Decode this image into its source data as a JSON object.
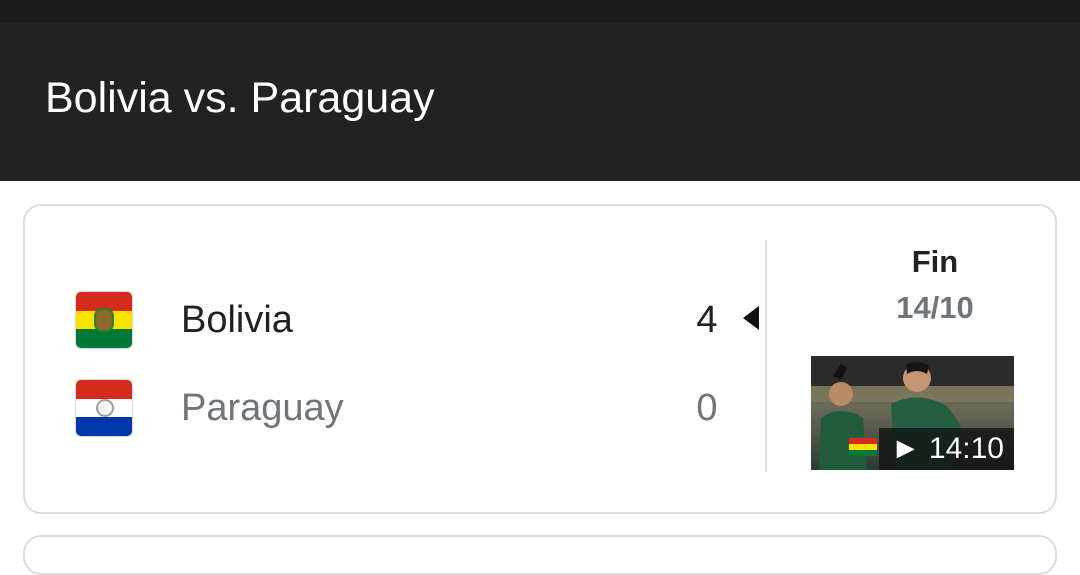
{
  "header": {
    "title": "Bolivia vs. Paraguay"
  },
  "match": {
    "home": {
      "name": "Bolivia",
      "score": "4",
      "flag_icon": "bolivia-flag-icon",
      "winner": true
    },
    "away": {
      "name": "Paraguay",
      "score": "0",
      "flag_icon": "paraguay-flag-icon",
      "winner": false
    },
    "status": "Fin",
    "date": "14/10",
    "highlight": {
      "duration": "14:10",
      "play_icon": "play-icon"
    }
  },
  "colors": {
    "header_bg": "#222222",
    "winner_text": "#202124",
    "loser_text": "#70757a",
    "bolivia": [
      "#d52b1e",
      "#f9e300",
      "#007934"
    ],
    "paraguay": [
      "#d52b1e",
      "#ffffff",
      "#0038a8"
    ]
  }
}
